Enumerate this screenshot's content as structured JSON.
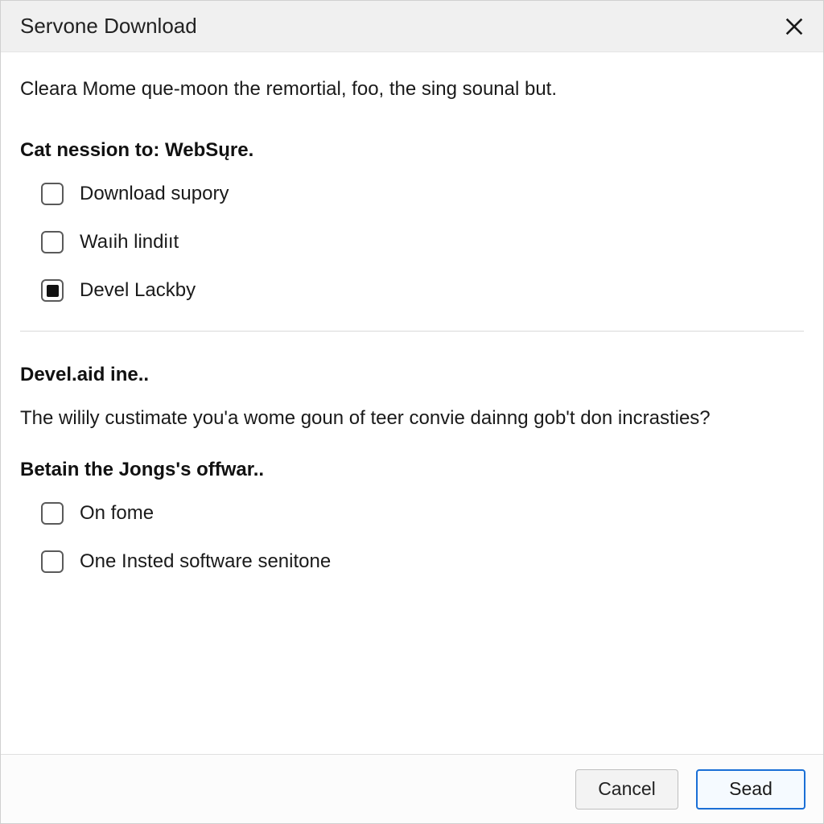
{
  "titlebar": {
    "title": "Servone Download"
  },
  "intro": "Cleara Mome que-moon the remortial, foo, the sing sounal but.",
  "section1": {
    "heading": "Cat nession to: WebSųre.",
    "options": [
      {
        "label": "Download supory",
        "checked": false
      },
      {
        "label": "Waıih lindiıt",
        "checked": false
      },
      {
        "label": "Devel Lackby",
        "checked": true
      }
    ]
  },
  "section2": {
    "heading": "Devel.aid ine..",
    "text": "The wilily custimate you'a wome goun of teer convie dainng gob't don incrasties?"
  },
  "section3": {
    "heading": "Betain the Jongs's offwar..",
    "options": [
      {
        "label": "On fome",
        "checked": false
      },
      {
        "label": "One Insted software senitone",
        "checked": false
      }
    ]
  },
  "footer": {
    "cancel": "Cancel",
    "primary": "Sead"
  }
}
